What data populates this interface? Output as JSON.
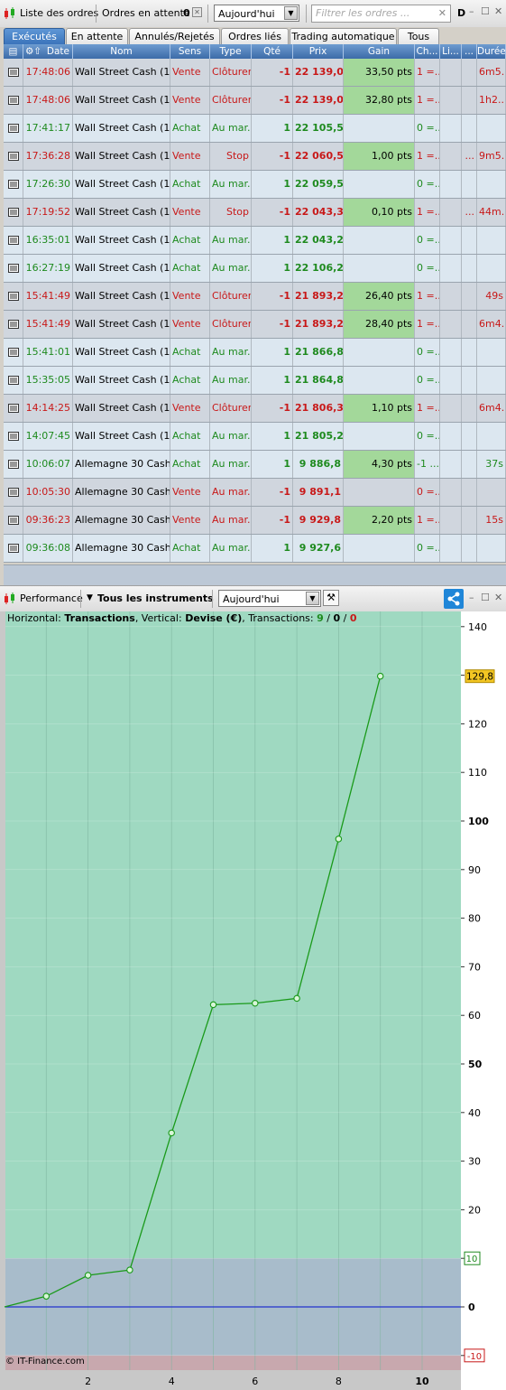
{
  "orders_panel": {
    "title": "Liste des ordres",
    "pending_label": "Ordres en attente",
    "pending_count": "0",
    "period": "Aujourd'hui",
    "filter_placeholder": "Filtrer les ordres ...",
    "right_label": "D",
    "tabs": [
      "Exécutés",
      "En attente",
      "Annulés/Rejetés",
      "Ordres liés",
      "Trading automatique",
      "Tous"
    ],
    "columns": [
      "Date",
      "Nom",
      "Sens",
      "Type",
      "Qté",
      "Prix",
      "Gain",
      "Ch...",
      "Li...",
      "...",
      "Durée"
    ],
    "rows": [
      {
        "time": "17:48:06",
        "name": "Wall Street Cash (1€)",
        "side": "Vente",
        "type": "Clôturer",
        "qty": "-1",
        "price": "22 139,0",
        "gain": "33,50 pts",
        "ch": "1 =...",
        "li": "",
        "x": "",
        "dur": "6m5..."
      },
      {
        "time": "17:48:06",
        "name": "Wall Street Cash (1€)",
        "side": "Vente",
        "type": "Clôturer",
        "qty": "-1",
        "price": "22 139,0",
        "gain": "32,80 pts",
        "ch": "1 =...",
        "li": "",
        "x": "",
        "dur": "1h2..."
      },
      {
        "time": "17:41:17",
        "name": "Wall Street Cash (1€)",
        "side": "Achat",
        "type": "Au mar...",
        "qty": "1",
        "price": "22 105,5",
        "gain": "",
        "ch": "0 =...",
        "li": "",
        "x": "",
        "dur": ""
      },
      {
        "time": "17:36:28",
        "name": "Wall Street Cash (1€)",
        "side": "Vente",
        "type": "Stop",
        "qty": "-1",
        "price": "22 060,5",
        "gain": "1,00 pts",
        "ch": "1 =...",
        "li": "",
        "x": "...",
        "dur": "9m5..."
      },
      {
        "time": "17:26:30",
        "name": "Wall Street Cash (1€)",
        "side": "Achat",
        "type": "Au mar...",
        "qty": "1",
        "price": "22 059,5",
        "gain": "",
        "ch": "0 =...",
        "li": "",
        "x": "",
        "dur": ""
      },
      {
        "time": "17:19:52",
        "name": "Wall Street Cash (1€)",
        "side": "Vente",
        "type": "Stop",
        "qty": "-1",
        "price": "22 043,3",
        "gain": "0,10 pts",
        "ch": "1 =...",
        "li": "",
        "x": "...",
        "dur": "44m..."
      },
      {
        "time": "16:35:01",
        "name": "Wall Street Cash (1€)",
        "side": "Achat",
        "type": "Au mar...",
        "qty": "1",
        "price": "22 043,2",
        "gain": "",
        "ch": "0 =...",
        "li": "",
        "x": "",
        "dur": ""
      },
      {
        "time": "16:27:19",
        "name": "Wall Street Cash (1€)",
        "side": "Achat",
        "type": "Au mar...",
        "qty": "1",
        "price": "22 106,2",
        "gain": "",
        "ch": "0 =...",
        "li": "",
        "x": "",
        "dur": ""
      },
      {
        "time": "15:41:49",
        "name": "Wall Street Cash (1€)",
        "side": "Vente",
        "type": "Clôturer",
        "qty": "-1",
        "price": "21 893,2",
        "gain": "26,40 pts",
        "ch": "1 =...",
        "li": "",
        "x": "",
        "dur": "49s"
      },
      {
        "time": "15:41:49",
        "name": "Wall Street Cash (1€)",
        "side": "Vente",
        "type": "Clôturer",
        "qty": "-1",
        "price": "21 893,2",
        "gain": "28,40 pts",
        "ch": "1 =...",
        "li": "",
        "x": "",
        "dur": "6m4..."
      },
      {
        "time": "15:41:01",
        "name": "Wall Street Cash (1€)",
        "side": "Achat",
        "type": "Au mar...",
        "qty": "1",
        "price": "21 866,8",
        "gain": "",
        "ch": "0 =...",
        "li": "",
        "x": "",
        "dur": ""
      },
      {
        "time": "15:35:05",
        "name": "Wall Street Cash (1€)",
        "side": "Achat",
        "type": "Au mar...",
        "qty": "1",
        "price": "21 864,8",
        "gain": "",
        "ch": "0 =...",
        "li": "",
        "x": "",
        "dur": ""
      },
      {
        "time": "14:14:25",
        "name": "Wall Street Cash (1€)",
        "side": "Vente",
        "type": "Clôturer",
        "qty": "-1",
        "price": "21 806,3",
        "gain": "1,10 pts",
        "ch": "1 =...",
        "li": "",
        "x": "",
        "dur": "6m4..."
      },
      {
        "time": "14:07:45",
        "name": "Wall Street Cash (1€)",
        "side": "Achat",
        "type": "Au mar...",
        "qty": "1",
        "price": "21 805,2",
        "gain": "",
        "ch": "0 =...",
        "li": "",
        "x": "",
        "dur": ""
      },
      {
        "time": "10:06:07",
        "name": "Allemagne 30 Cash ...",
        "side": "Achat",
        "type": "Au mar...",
        "qty": "1",
        "price": "9 886,8",
        "gain": "4,30 pts",
        "ch": "-1 ...",
        "li": "",
        "x": "",
        "dur": "37s"
      },
      {
        "time": "10:05:30",
        "name": "Allemagne 30 Cash ...",
        "side": "Vente",
        "type": "Au mar...",
        "qty": "-1",
        "price": "9 891,1",
        "gain": "",
        "ch": "0 =...",
        "li": "",
        "x": "",
        "dur": ""
      },
      {
        "time": "09:36:23",
        "name": "Allemagne 30 Cash ...",
        "side": "Vente",
        "type": "Au mar...",
        "qty": "-1",
        "price": "9 929,8",
        "gain": "2,20 pts",
        "ch": "1 =...",
        "li": "",
        "x": "",
        "dur": "15s"
      },
      {
        "time": "09:36:08",
        "name": "Allemagne 30 Cash ...",
        "side": "Achat",
        "type": "Au mar...",
        "qty": "1",
        "price": "9 927,6",
        "gain": "",
        "ch": "0 =...",
        "li": "",
        "x": "",
        "dur": ""
      }
    ]
  },
  "performance_panel": {
    "title": "Performance",
    "instruments": "Tous les instruments",
    "period": "Aujourd'hui",
    "info_prefix": "Horizontal: ",
    "info_h": "Transactions",
    "info_mid": ", Vertical: ",
    "info_v": "Devise (€)",
    "info_tx": ", Transactions: ",
    "tx_green": "9",
    "tx_sep1": " / ",
    "tx_zero": "0",
    "tx_sep2": " / ",
    "tx_red": "0",
    "copyright": "© IT-Finance.com",
    "last_value_label": "129,8",
    "threshold_up_label": "10",
    "threshold_down_label": "-10"
  },
  "chart_data": {
    "type": "line",
    "x": [
      0,
      1,
      2,
      3,
      4,
      5,
      6,
      7,
      8,
      9
    ],
    "values": [
      0,
      2.2,
      6.5,
      7.6,
      35.8,
      62.2,
      62.5,
      63.5,
      96.3,
      129.8
    ],
    "xlim": [
      0,
      11
    ],
    "ylim": [
      -10,
      141
    ],
    "xticks": [
      "2",
      "4",
      "6",
      "8",
      "10"
    ],
    "yticks": [
      "140",
      "130",
      "120",
      "110",
      "100",
      "90",
      "80",
      "70",
      "60",
      "50",
      "40",
      "30",
      "20",
      "10",
      "0",
      "-10"
    ],
    "grid": true,
    "colors": {
      "line": "#1a9a1a",
      "zero_line": "#2233cc",
      "profit_zone": "#9fd9c1",
      "neutral_zone": "#a8bccb",
      "loss_zone": "#c8a8ae"
    }
  }
}
